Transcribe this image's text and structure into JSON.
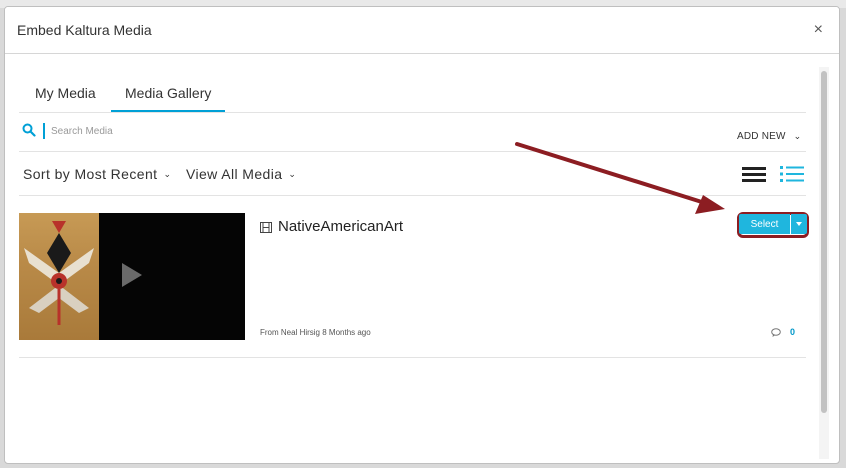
{
  "dialog": {
    "title": "Embed Kaltura Media",
    "close_label": "×"
  },
  "tabs": [
    {
      "label": "My Media"
    },
    {
      "label": "Media Gallery"
    }
  ],
  "search": {
    "placeholder": "Search Media",
    "icon": "search-icon"
  },
  "toolbar": {
    "add_new_label": "ADD NEW",
    "sort_label": "Sort by Most Recent",
    "view_label": "View All Media",
    "list_view_icon": "list-view-icon",
    "detail_view_icon": "detail-view-icon"
  },
  "entry": {
    "title": "NativeAmericanArt",
    "type_icon": "video-icon",
    "select_label": "Select",
    "meta": "From Neal Hirsig 8 Months ago",
    "comment_count": "0"
  },
  "colors": {
    "accent": "#00a0d6",
    "select_button": "#1fb6de",
    "annotation": "#8c1d22"
  }
}
